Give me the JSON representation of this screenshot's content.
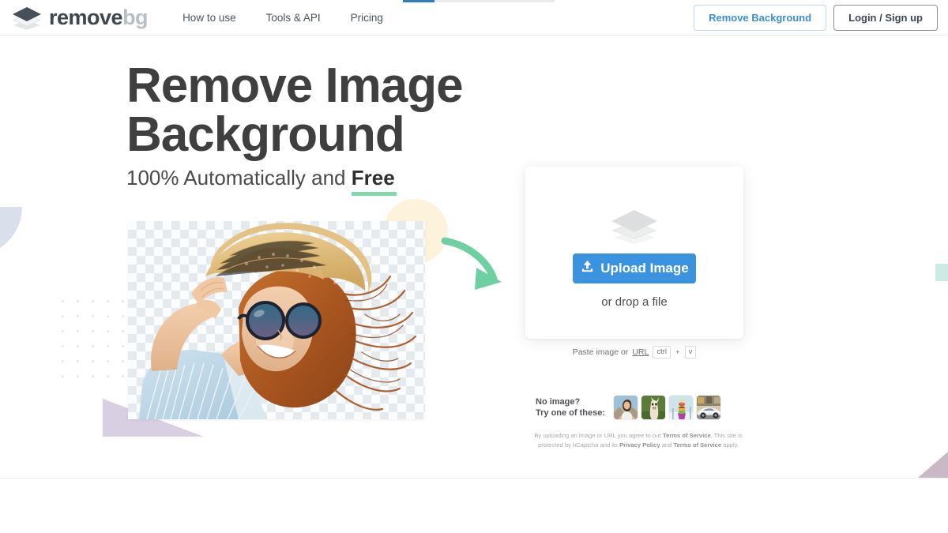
{
  "brand": {
    "name_bold": "remove",
    "name_light": "bg",
    "logo_icon": "layers-icon"
  },
  "nav": {
    "items": [
      {
        "label": "How to use"
      },
      {
        "label": "Tools & API"
      },
      {
        "label": "Pricing"
      }
    ]
  },
  "header_actions": {
    "remove_background": "Remove Background",
    "login_signup": "Login / Sign up"
  },
  "hero": {
    "title_line1": "Remove Image",
    "title_line2": "Background",
    "subtitle_prefix": "100% Automatically and ",
    "subtitle_highlight": "Free"
  },
  "upload_card": {
    "layers_icon": "layers-icon",
    "upload_icon": "upload-icon",
    "upload_label": "Upload Image",
    "drop_label": "or drop a file"
  },
  "paste": {
    "prefix": "Paste image or ",
    "url_label": "URL",
    "key_ctrl": "ctrl",
    "key_plus": "+",
    "key_v": "v"
  },
  "samples": {
    "line1": "No image?",
    "line2": "Try one of these:",
    "thumbnails": [
      {
        "name": "sample-woman"
      },
      {
        "name": "sample-llama"
      },
      {
        "name": "sample-product"
      },
      {
        "name": "sample-car"
      }
    ]
  },
  "legal": {
    "part1": "By uploading an image or URL you agree to our ",
    "tos1": "Terms of Service",
    "part2": ". This site is protected by hCaptcha and its ",
    "privacy": "Privacy Policy",
    "part3": " and ",
    "tos2": "Terms of Service",
    "part4": " apply."
  },
  "colors": {
    "accent_blue": "#3b93e0",
    "link_blue": "#3a8fd6",
    "underline_green": "#7fd8ae",
    "arrow_green": "#6ecfa3",
    "heading": "#3f3f3f"
  },
  "progress": {
    "value_pct": 21
  }
}
